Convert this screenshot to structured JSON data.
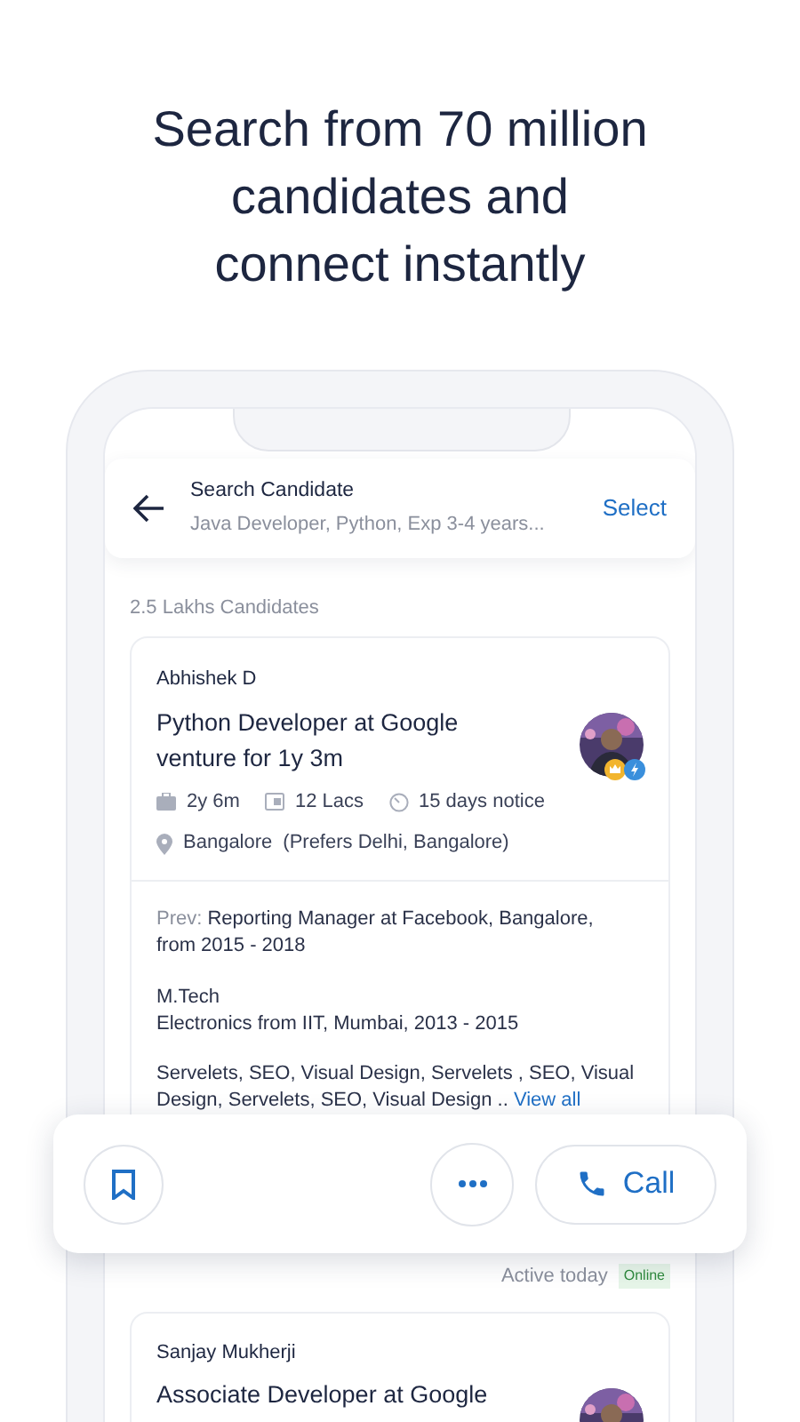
{
  "headline_lines": [
    "Search from 70 million",
    "candidates and",
    "connect instantly"
  ],
  "search_header": {
    "title": "Search Candidate",
    "subtitle": "Java Developer, Python, Exp 3-4 years...",
    "action": "Select"
  },
  "result_count": "2.5 Lakhs Candidates",
  "candidates": [
    {
      "name": "Abhishek D",
      "headline": "Python Developer at Google venture for 1y 3m",
      "experience": "2y 6m",
      "salary": "12 Lacs",
      "notice": "15 days notice",
      "location": "Bangalore",
      "preferred": "(Prefers Delhi, Bangalore)",
      "previous_label": "Prev:",
      "previous": "Reporting Manager at Facebook, Bangalore, from 2015 - 2018",
      "degree": "M.Tech",
      "education": "Electronics from IIT, Mumbai, 2013 - 2015",
      "skills": "Servelets, SEO, Visual Design, Servelets , SEO, Visual Design, Servelets, SEO, Visual Design  ..",
      "view_all": "View all",
      "activity": "Active today",
      "status": "Online"
    },
    {
      "name": "Sanjay Mukherji",
      "headline": "Associate Developer at Google"
    }
  ],
  "action_bar": {
    "call": "Call"
  }
}
